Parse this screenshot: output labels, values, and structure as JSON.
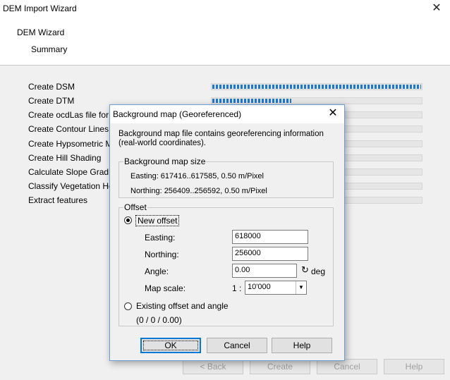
{
  "wizard": {
    "title": "DEM Import Wizard",
    "close_glyph": "✕",
    "heading": "DEM Wizard",
    "subheading": "Summary",
    "steps": [
      {
        "label": "Create DSM",
        "progress": 1.0
      },
      {
        "label": "Create DTM",
        "progress": 0.38
      },
      {
        "label": "Create ocdLas file for L",
        "progress": 0.0
      },
      {
        "label": "Create Contour Lines",
        "progress": 0.0
      },
      {
        "label": "Create Hypsometric Ma",
        "progress": 0.0
      },
      {
        "label": "Create Hill Shading",
        "progress": 0.0
      },
      {
        "label": "Calculate Slope Gradie",
        "progress": 0.0
      },
      {
        "label": "Classify Vegetation He",
        "progress": 0.0
      },
      {
        "label": "Extract features",
        "progress": 0.0
      }
    ],
    "buttons": {
      "back": "< Back",
      "create": "Create",
      "cancel": "Cancel",
      "help": "Help"
    }
  },
  "dialog": {
    "title": "Background map (Georeferenced)",
    "close_glyph": "✕",
    "message": "Background map file contains georeferencing information (real-world coordinates).",
    "size_group": {
      "caption": "Background map size",
      "easting": "Easting: 617416..617585,  0.50 m/Pixel",
      "northing": "Northing: 256409..256592,  0.50 m/Pixel"
    },
    "offset_group": {
      "caption": "Offset",
      "new_offset_label": "New offset",
      "new_offset_selected": true,
      "easting_label": "Easting:",
      "easting_value": "618000",
      "northing_label": "Northing:",
      "northing_value": "256000",
      "angle_label": "Angle:",
      "angle_value": "0.00",
      "angle_unit": "deg",
      "scale_label": "Map scale:",
      "scale_prefix": "1 :",
      "scale_value": "10'000",
      "existing_label": "Existing offset and angle",
      "existing_value": "(0 / 0 / 0.00)"
    },
    "buttons": {
      "ok": "OK",
      "cancel": "Cancel",
      "help": "Help"
    }
  }
}
